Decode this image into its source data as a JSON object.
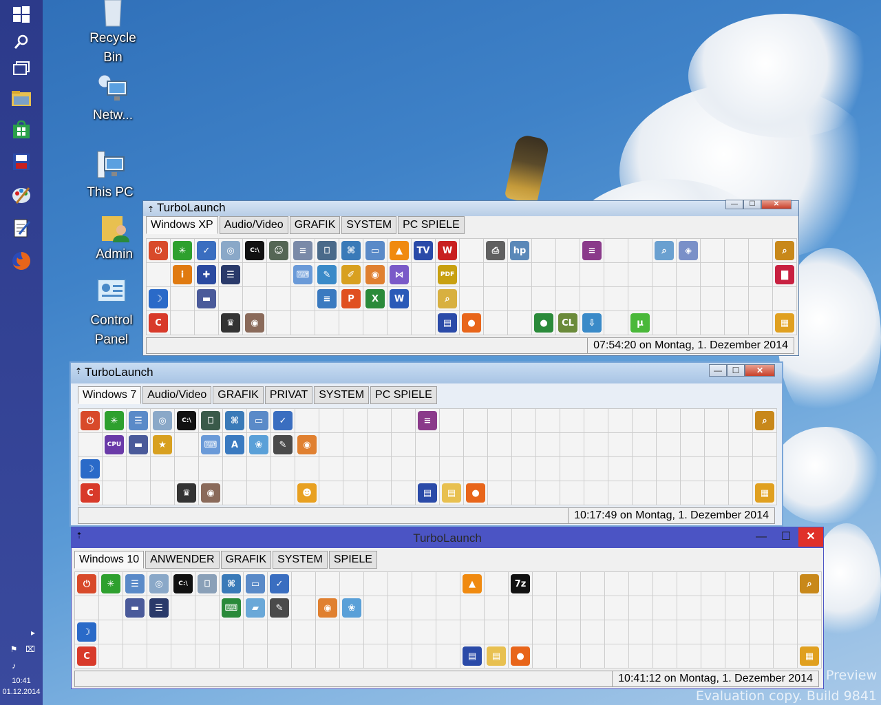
{
  "desktop": {
    "icons": [
      {
        "label": "Recycle\nBin",
        "icon": "recycle-bin-icon"
      },
      {
        "label": "Netw...",
        "icon": "network-icon"
      },
      {
        "label": "This PC",
        "icon": "this-pc-icon"
      },
      {
        "label": "Admin",
        "icon": "user-folder-icon"
      },
      {
        "label": "Control\nPanel",
        "icon": "control-panel-icon"
      }
    ],
    "watermark_line1": "l Preview",
    "watermark_line2": "Evaluation copy. Build 9841"
  },
  "taskbar": {
    "buttons": [
      "start-icon",
      "search-icon",
      "task-view-icon",
      "file-explorer-icon",
      "store-icon",
      "save-icon",
      "paint-icon",
      "notepad-icon",
      "firefox-icon"
    ],
    "clock_time": "10:41",
    "clock_date": "01.12.2014"
  },
  "windows": [
    {
      "id": "xp",
      "title": "TurboLaunch",
      "tabs": [
        "Windows XP",
        "Audio/Video",
        "GRAFIK",
        "SYSTEM",
        "PC SPIELE"
      ],
      "active_tab": 0,
      "status_time": "07:54:20 on Montag, 1. Dezember 2014",
      "cols": 27,
      "rows": 4,
      "icons": [
        [
          0,
          0,
          "power-icon",
          "#d84a2a",
          "⏻"
        ],
        [
          0,
          1,
          "sparkle-icon",
          "#2ea02e",
          "✳"
        ],
        [
          0,
          2,
          "check-icon",
          "#3a6ec0",
          "✓"
        ],
        [
          0,
          3,
          "cd-icon",
          "#8aa8c8",
          "◎"
        ],
        [
          0,
          4,
          "cmd-icon",
          "#111111",
          "C:\\"
        ],
        [
          0,
          5,
          "mascot-icon",
          "#556655",
          "☺"
        ],
        [
          0,
          6,
          "doc-icon",
          "#7a8aa8",
          "≡"
        ],
        [
          0,
          7,
          "monitor-icon",
          "#4a6a8a",
          "⎕"
        ],
        [
          0,
          8,
          "network-icon",
          "#3a7ab8",
          "⌘"
        ],
        [
          0,
          9,
          "window-icon",
          "#5a8ac8",
          "▭"
        ],
        [
          0,
          10,
          "vlc-icon",
          "#f08a10",
          "▲"
        ],
        [
          0,
          11,
          "tv-icon",
          "#2a4aa8",
          "TV"
        ],
        [
          0,
          12,
          "wintv-icon",
          "#c82020",
          "W"
        ],
        [
          0,
          14,
          "printer-icon",
          "#606060",
          "⎙"
        ],
        [
          0,
          15,
          "hp-icon",
          "#5a88b8",
          "hp"
        ],
        [
          0,
          18,
          "winrar-icon",
          "#8a3a8a",
          "≡"
        ],
        [
          0,
          21,
          "search-doc-icon",
          "#6aa0d0",
          "⌕"
        ],
        [
          0,
          22,
          "box-icon",
          "#7a90c8",
          "◈"
        ],
        [
          0,
          26,
          "magnifier-icon",
          "#c8881a",
          "⌕"
        ],
        [
          1,
          1,
          "info-icon",
          "#e07a10",
          "i"
        ],
        [
          1,
          2,
          "plus-icon",
          "#2a4aa0",
          "✚"
        ],
        [
          1,
          3,
          "equalizer-icon",
          "#2a3a6a",
          "☰"
        ],
        [
          1,
          6,
          "calculator-icon",
          "#6a9ad8",
          "⌨"
        ],
        [
          1,
          7,
          "notepad-icon",
          "#3a8ac8",
          "✎"
        ],
        [
          1,
          8,
          "brushes-icon",
          "#d8a020",
          "✐"
        ],
        [
          1,
          9,
          "eye-icon",
          "#e08030",
          "◉"
        ],
        [
          1,
          10,
          "bowtie-icon",
          "#7a5ac8",
          "⋈"
        ],
        [
          1,
          12,
          "pdf-icon",
          "#c8a010",
          "PDF"
        ],
        [
          1,
          26,
          "chart-icon",
          "#c82040",
          "▇"
        ],
        [
          2,
          0,
          "ccleaner-moon-icon",
          "#2a6ac8",
          "☽"
        ],
        [
          2,
          2,
          "drive-icon",
          "#4a5a9a",
          "▬"
        ],
        [
          2,
          7,
          "wordpad-icon",
          "#3a7ac0",
          "≡"
        ],
        [
          2,
          8,
          "powerpoint-icon",
          "#e05020",
          "P"
        ],
        [
          2,
          9,
          "excel-icon",
          "#2a8a3a",
          "X"
        ],
        [
          2,
          10,
          "word-icon",
          "#2a5ab8",
          "W"
        ],
        [
          2,
          12,
          "zoom-icon",
          "#d8b040",
          "⌕"
        ],
        [
          3,
          0,
          "ccleaner-icon",
          "#d83a2a",
          "C"
        ],
        [
          3,
          3,
          "magic-hat-icon",
          "#333333",
          "♛"
        ],
        [
          3,
          4,
          "disc-icon",
          "#8a6a5a",
          "◉"
        ],
        [
          3,
          12,
          "floppy-icon",
          "#2a4aa8",
          "▤"
        ],
        [
          3,
          13,
          "firefox-icon",
          "#e8651a",
          "●"
        ],
        [
          3,
          16,
          "globe-icon",
          "#2a8a3a",
          "●"
        ],
        [
          3,
          17,
          "cl-icon",
          "#6a8a3a",
          "CL"
        ],
        [
          3,
          18,
          "download-icon",
          "#3a8ac8",
          "⇩"
        ],
        [
          3,
          20,
          "utorrent-icon",
          "#4ab83a",
          "µ"
        ],
        [
          3,
          26,
          "avast-icon",
          "#e0a020",
          "▦"
        ]
      ]
    },
    {
      "id": "w7",
      "title": "TurboLaunch",
      "tabs": [
        "Windows 7",
        "Audio/Video",
        "GRAFIK",
        "PRIVAT",
        "SYSTEM",
        "PC SPIELE"
      ],
      "active_tab": 0,
      "status_time": "10:17:49 on Montag, 1. Dezember 2014",
      "cols": 29,
      "rows": 4,
      "icons": [
        [
          0,
          0,
          "power-icon",
          "#d84a2a",
          "⏻"
        ],
        [
          0,
          1,
          "sparkle-icon",
          "#2ea02e",
          "✳"
        ],
        [
          0,
          2,
          "control-panel-icon",
          "#5a8ac8",
          "☰"
        ],
        [
          0,
          3,
          "cd-icon",
          "#8aa8c8",
          "◎"
        ],
        [
          0,
          4,
          "cmd-icon",
          "#111111",
          "C:\\"
        ],
        [
          0,
          5,
          "monitor-icon",
          "#3a5a4a",
          "⎕"
        ],
        [
          0,
          6,
          "network-icon",
          "#3a7ab8",
          "⌘"
        ],
        [
          0,
          7,
          "window-icon",
          "#5a8ac8",
          "▭"
        ],
        [
          0,
          8,
          "check-icon",
          "#3a6ec0",
          "✓"
        ],
        [
          0,
          14,
          "winrar-icon",
          "#8a3a8a",
          "≡"
        ],
        [
          0,
          28,
          "magnifier-icon",
          "#c8881a",
          "⌕"
        ],
        [
          1,
          1,
          "cpuz-icon",
          "#6a3aa8",
          "CPU"
        ],
        [
          1,
          2,
          "drive-icon",
          "#4a5a9a",
          "▬"
        ],
        [
          1,
          3,
          "star-icon",
          "#d8a020",
          "★"
        ],
        [
          1,
          5,
          "calculator-icon",
          "#6a9ad8",
          "⌨"
        ],
        [
          1,
          6,
          "wordpad-icon",
          "#3a7ac0",
          "A"
        ],
        [
          1,
          7,
          "paint-icon",
          "#5aa0d8",
          "❀"
        ],
        [
          1,
          8,
          "notepad-icon",
          "#4a4a4a",
          "✎"
        ],
        [
          1,
          9,
          "eye-icon",
          "#e08030",
          "◉"
        ],
        [
          2,
          0,
          "ccleaner-moon-icon",
          "#2a6ac8",
          "☽"
        ],
        [
          3,
          0,
          "ccleaner-icon",
          "#d83a2a",
          "C"
        ],
        [
          3,
          4,
          "magic-hat-icon",
          "#333333",
          "♛"
        ],
        [
          3,
          5,
          "disc-icon",
          "#8a6a5a",
          "◉"
        ],
        [
          3,
          9,
          "duck-icon",
          "#e8a020",
          "☻"
        ],
        [
          3,
          14,
          "floppy-icon",
          "#2a4aa8",
          "▤"
        ],
        [
          3,
          15,
          "folder-icon",
          "#e8c050",
          "▤"
        ],
        [
          3,
          16,
          "firefox-icon",
          "#e8651a",
          "●"
        ],
        [
          3,
          28,
          "avast-icon",
          "#e0a020",
          "▦"
        ]
      ]
    },
    {
      "id": "w10",
      "title": "TurboLaunch",
      "tabs": [
        "Windows 10",
        "ANWENDER",
        "GRAFIK",
        "SYSTEM",
        "SPIELE"
      ],
      "active_tab": 0,
      "status_time": "10:41:12 on Montag, 1. Dezember 2014",
      "cols": 31,
      "rows": 4,
      "icons": [
        [
          0,
          0,
          "power-icon",
          "#d84a2a",
          "⏻"
        ],
        [
          0,
          1,
          "sparkle-icon",
          "#2ea02e",
          "✳"
        ],
        [
          0,
          2,
          "control-panel-icon",
          "#5a8ac8",
          "☰"
        ],
        [
          0,
          3,
          "cd-icon",
          "#8aa8c8",
          "◎"
        ],
        [
          0,
          4,
          "cmd-icon",
          "#111111",
          "C:\\"
        ],
        [
          0,
          5,
          "monitor-icon",
          "#8aa0b8",
          "⎕"
        ],
        [
          0,
          6,
          "network-icon",
          "#3a7ab8",
          "⌘"
        ],
        [
          0,
          7,
          "window-icon",
          "#5a8ac8",
          "▭"
        ],
        [
          0,
          8,
          "check-icon",
          "#3a6ec0",
          "✓"
        ],
        [
          0,
          16,
          "vlc-icon",
          "#f08a10",
          "▲"
        ],
        [
          0,
          18,
          "7zip-icon",
          "#111111",
          "7z"
        ],
        [
          0,
          30,
          "magnifier-icon",
          "#c8881a",
          "⌕"
        ],
        [
          1,
          2,
          "drive-icon",
          "#4a5a9a",
          "▬"
        ],
        [
          1,
          3,
          "equalizer-icon",
          "#2a3a6a",
          "☰"
        ],
        [
          1,
          6,
          "calculator-icon",
          "#2a8a3a",
          "⌨"
        ],
        [
          1,
          7,
          "eraser-icon",
          "#6aa8d8",
          "▰"
        ],
        [
          1,
          8,
          "notepad-icon",
          "#4a4a4a",
          "✎"
        ],
        [
          1,
          10,
          "eye-icon",
          "#e08030",
          "◉"
        ],
        [
          1,
          11,
          "paint-icon",
          "#5aa0d8",
          "❀"
        ],
        [
          2,
          0,
          "ccleaner-moon-icon",
          "#2a6ac8",
          "☽"
        ],
        [
          3,
          0,
          "ccleaner-icon",
          "#d83a2a",
          "C"
        ],
        [
          3,
          16,
          "floppy-icon",
          "#2a4aa8",
          "▤"
        ],
        [
          3,
          17,
          "folder-icon",
          "#e8c050",
          "▤"
        ],
        [
          3,
          18,
          "firefox-icon",
          "#e8651a",
          "●"
        ],
        [
          3,
          30,
          "avast-icon",
          "#e0a020",
          "▦"
        ]
      ]
    }
  ]
}
